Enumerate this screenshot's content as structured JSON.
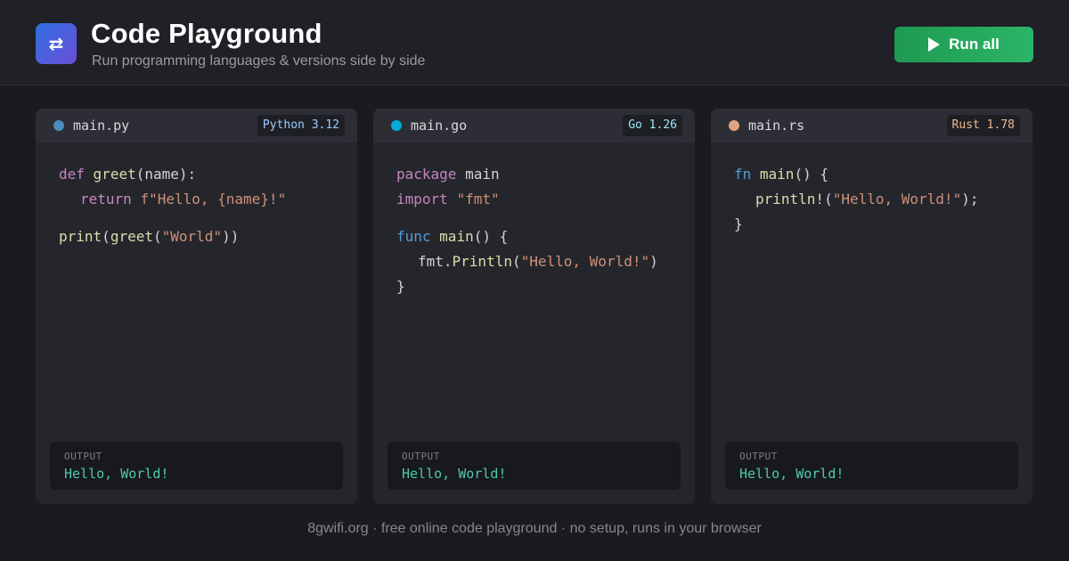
{
  "header": {
    "logo_glyph": "⇄",
    "title": "Code Playground",
    "subtitle": "Run programming languages & versions side by side",
    "run_all_label": "Run all"
  },
  "colors": {
    "python_dot": "#4b8bbe",
    "go_dot": "#00add8",
    "rust_dot": "#dea584",
    "run_button": "#2bb468"
  },
  "cards": [
    {
      "filename": "main.py",
      "badge": "Python 3.12",
      "badge_color": "#9ecbff",
      "code": {
        "l1_kw": "def",
        "l1_fn": "greet",
        "l1_rest": "(name):",
        "l2_kw": "return",
        "l2_str": "f\"Hello, {name}!\"",
        "l3_fn": "print",
        "l3_p1": "(",
        "l3_fn2": "greet",
        "l3_p2": "(",
        "l3_str": "\"World\"",
        "l3_p3": "))"
      },
      "output_label": "OUTPUT",
      "output": "Hello, World!"
    },
    {
      "filename": "main.go",
      "badge": "Go 1.26",
      "badge_color": "#9fe6f5",
      "code": {
        "l1_kw": "package",
        "l1_rest": " main",
        "l2_kw": "import",
        "l2_str": "\"fmt\"",
        "l3_kw": "func",
        "l3_fn": "main",
        "l3_rest": "() {",
        "l4_a": "fmt.",
        "l4_fn": "Println",
        "l4_p1": "(",
        "l4_str": "\"Hello, World!\"",
        "l4_p2": ")",
        "l5": "}"
      },
      "output_label": "OUTPUT",
      "output": "Hello, World!"
    },
    {
      "filename": "main.rs",
      "badge": "Rust 1.78",
      "badge_color": "#f4b98c",
      "code": {
        "l1_kw": "fn",
        "l1_fn": "main",
        "l1_rest": "() {",
        "l2_fn": "println!",
        "l2_p1": "(",
        "l2_str": "\"Hello, World!\"",
        "l2_p2": ");",
        "l3": "}"
      },
      "output_label": "OUTPUT",
      "output": "Hello, World!"
    }
  ],
  "footer": "8gwifi.org · free online code playground · no setup, runs in your browser"
}
